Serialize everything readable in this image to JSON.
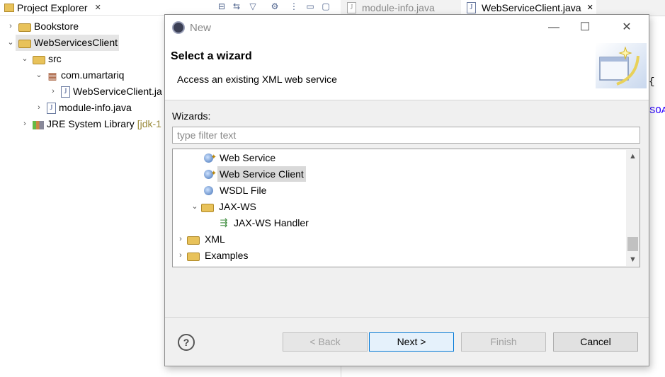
{
  "project_explorer": {
    "tab_label": "Project Explorer",
    "close_glyph": "✕",
    "tree": [
      {
        "label": "Bookstore",
        "icon": "folder-icon"
      },
      {
        "label": "WebServicesClient",
        "icon": "project-folder-icon"
      },
      {
        "label": "src",
        "icon": "source-folder-icon"
      },
      {
        "label": "com.umartariq",
        "icon": "package-icon"
      },
      {
        "label": "WebServiceClient.ja",
        "icon": "java-file-icon"
      },
      {
        "label": "module-info.java",
        "icon": "java-file-icon"
      },
      {
        "label": "JRE System Library",
        "suffix": "[jdk-1",
        "icon": "library-icon"
      }
    ]
  },
  "editor": {
    "tabs": [
      {
        "label": "module-info.java"
      },
      {
        "label": "WebServiceClient.java",
        "close_glyph": "✕"
      }
    ],
    "code_brace": "{",
    "code_soa": "SOA"
  },
  "dialog": {
    "title": "New",
    "heading": "Select a wizard",
    "description": "Access an existing XML web service",
    "wizards_label": "Wizards:",
    "filter_placeholder": "type filter text",
    "list": [
      {
        "label": "Web Service",
        "icon": "web-service-icon"
      },
      {
        "label": "Web Service Client",
        "icon": "web-service-client-icon",
        "selected": true
      },
      {
        "label": "WSDL File",
        "icon": "wsdl-icon"
      },
      {
        "label": "JAX-WS",
        "icon": "folder-icon",
        "expanded": true
      },
      {
        "label": "JAX-WS Handler",
        "icon": "handler-icon"
      },
      {
        "label": "XML",
        "icon": "folder-icon"
      },
      {
        "label": "Examples",
        "icon": "folder-icon"
      }
    ],
    "buttons": {
      "help": "?",
      "back": "< Back",
      "next": "Next >",
      "finish": "Finish",
      "cancel": "Cancel"
    }
  }
}
